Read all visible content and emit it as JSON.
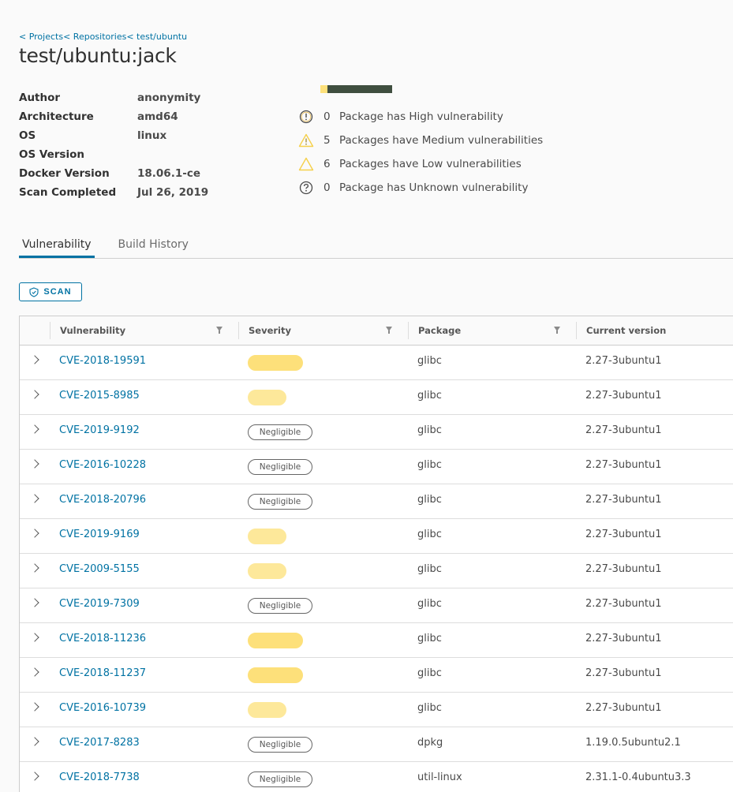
{
  "breadcrumb": {
    "projects": "< Projects",
    "repositories": "< Repositories",
    "repo": "< test/ubuntu"
  },
  "title": "test/ubuntu:jack",
  "properties": [
    {
      "label": "Author",
      "value": "anonymity"
    },
    {
      "label": "Architecture",
      "value": "amd64"
    },
    {
      "label": "OS",
      "value": "linux"
    },
    {
      "label": "OS Version",
      "value": ""
    },
    {
      "label": "Docker Version",
      "value": "18.06.1-ce"
    },
    {
      "label": "Scan Completed",
      "value": "Jul 26, 2019"
    }
  ],
  "severity_bar": {
    "medium_fraction": 0.1,
    "colors": {
      "medium": "#fde07a",
      "low": "#3f4e3f"
    }
  },
  "summary": [
    {
      "icon": "exclamation-circle-icon",
      "count": "0",
      "text": "Package has High vulnerability"
    },
    {
      "icon": "warning-triangle-icon",
      "count": "5",
      "text": "Packages have Medium vulnerabilities"
    },
    {
      "icon": "outline-triangle-icon",
      "count": "6",
      "text": "Packages have Low vulnerabilities"
    },
    {
      "icon": "question-circle-icon",
      "count": "0",
      "text": "Package has Unknown vulnerability"
    }
  ],
  "tabs": [
    {
      "label": "Vulnerability",
      "active": true
    },
    {
      "label": "Build History",
      "active": false
    }
  ],
  "scan_button": {
    "label": "SCAN",
    "icon": "shield-icon"
  },
  "columns": [
    "Vulnerability",
    "Severity",
    "Package",
    "Current version"
  ],
  "rows": [
    {
      "cve": "CVE-2018-19591",
      "severity": "medium",
      "severity_label": "",
      "package": "glibc",
      "version": "2.27-3ubuntu1"
    },
    {
      "cve": "CVE-2015-8985",
      "severity": "low",
      "severity_label": "",
      "package": "glibc",
      "version": "2.27-3ubuntu1"
    },
    {
      "cve": "CVE-2019-9192",
      "severity": "negligible",
      "severity_label": "Negligible",
      "package": "glibc",
      "version": "2.27-3ubuntu1"
    },
    {
      "cve": "CVE-2016-10228",
      "severity": "negligible",
      "severity_label": "Negligible",
      "package": "glibc",
      "version": "2.27-3ubuntu1"
    },
    {
      "cve": "CVE-2018-20796",
      "severity": "negligible",
      "severity_label": "Negligible",
      "package": "glibc",
      "version": "2.27-3ubuntu1"
    },
    {
      "cve": "CVE-2019-9169",
      "severity": "low",
      "severity_label": "",
      "package": "glibc",
      "version": "2.27-3ubuntu1"
    },
    {
      "cve": "CVE-2009-5155",
      "severity": "low",
      "severity_label": "",
      "package": "glibc",
      "version": "2.27-3ubuntu1"
    },
    {
      "cve": "CVE-2019-7309",
      "severity": "negligible",
      "severity_label": "Negligible",
      "package": "glibc",
      "version": "2.27-3ubuntu1"
    },
    {
      "cve": "CVE-2018-11236",
      "severity": "medium",
      "severity_label": "",
      "package": "glibc",
      "version": "2.27-3ubuntu1"
    },
    {
      "cve": "CVE-2018-11237",
      "severity": "medium",
      "severity_label": "",
      "package": "glibc",
      "version": "2.27-3ubuntu1"
    },
    {
      "cve": "CVE-2016-10739",
      "severity": "low",
      "severity_label": "",
      "package": "glibc",
      "version": "2.27-3ubuntu1"
    },
    {
      "cve": "CVE-2017-8283",
      "severity": "negligible",
      "severity_label": "Negligible",
      "package": "dpkg",
      "version": "1.19.0.5ubuntu2.1"
    },
    {
      "cve": "CVE-2018-7738",
      "severity": "negligible",
      "severity_label": "Negligible",
      "package": "util-linux",
      "version": "2.31.1-0.4ubuntu3.3"
    }
  ]
}
